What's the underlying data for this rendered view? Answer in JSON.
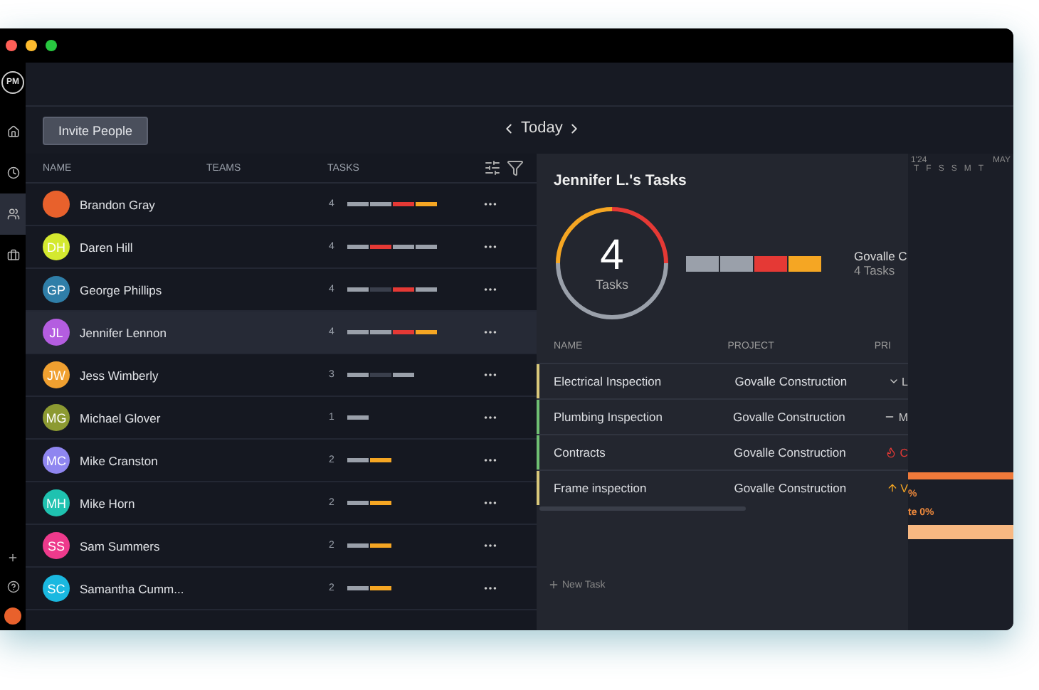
{
  "sidebar": {
    "logo": "PM",
    "items": [
      {
        "kind": "home",
        "selected": false
      },
      {
        "kind": "clock",
        "selected": false
      },
      {
        "kind": "people",
        "selected": true
      },
      {
        "kind": "briefcase",
        "selected": false
      }
    ],
    "bottom": [
      {
        "kind": "plus"
      },
      {
        "kind": "help"
      },
      {
        "kind": "avatar"
      }
    ]
  },
  "toolbar": {
    "invite_button": "Invite People",
    "date_nav": "Today"
  },
  "members": {
    "columns": [
      "NAME",
      "TEAMS",
      "TASKS"
    ],
    "rows": [
      {
        "initials": "",
        "color": "#e8612c",
        "name": "Brandon Gray",
        "count": "4",
        "selected": false,
        "segments": [
          {
            "color": "#9aa0aa"
          },
          {
            "color": "#9aa0aa"
          },
          {
            "color": "#e53935"
          },
          {
            "color": "#f5a623"
          }
        ]
      },
      {
        "initials": "DH",
        "color": "#d4e92f",
        "name": "Daren Hill",
        "count": "4",
        "selected": false,
        "segments": [
          {
            "color": "#9aa0aa"
          },
          {
            "color": "#e53935"
          },
          {
            "color": "#9aa0aa"
          },
          {
            "color": "#9aa0aa"
          }
        ]
      },
      {
        "initials": "GP",
        "color": "#2f7ea8",
        "name": "George Phillips",
        "count": "4",
        "selected": false,
        "segments": [
          {
            "color": "#9aa0aa"
          },
          {
            "color": "#3a3f4c"
          },
          {
            "color": "#e53935"
          },
          {
            "color": "#9aa0aa"
          }
        ]
      },
      {
        "initials": "JL",
        "color": "#b45de0",
        "name": "Jennifer Lennon",
        "count": "4",
        "selected": true,
        "segments": [
          {
            "color": "#9aa0aa"
          },
          {
            "color": "#9aa0aa"
          },
          {
            "color": "#e53935"
          },
          {
            "color": "#f5a623"
          }
        ]
      },
      {
        "initials": "JW",
        "color": "#f0a030",
        "name": "Jess Wimberly",
        "count": "3",
        "selected": false,
        "segments": [
          {
            "color": "#9aa0aa"
          },
          {
            "color": "#3a3f4c"
          },
          {
            "color": "#9aa0aa"
          }
        ]
      },
      {
        "initials": "MG",
        "color": "#8c9a32",
        "name": "Michael Glover",
        "count": "1",
        "selected": false,
        "segments": [
          {
            "color": "#9aa0aa"
          }
        ]
      },
      {
        "initials": "MC",
        "color": "#8f86f0",
        "name": "Mike Cranston",
        "count": "2",
        "selected": false,
        "segments": [
          {
            "color": "#9aa0aa"
          },
          {
            "color": "#f5a623"
          }
        ]
      },
      {
        "initials": "MH",
        "color": "#1fc2b0",
        "name": "Mike Horn",
        "count": "2",
        "selected": false,
        "segments": [
          {
            "color": "#9aa0aa"
          },
          {
            "color": "#f5a623"
          }
        ]
      },
      {
        "initials": "SS",
        "color": "#ee3a8c",
        "name": "Sam Summers",
        "count": "2",
        "selected": false,
        "segments": [
          {
            "color": "#9aa0aa"
          },
          {
            "color": "#f5a623"
          }
        ]
      },
      {
        "initials": "SC",
        "color": "#1ab8e0",
        "name": "Samantha Cumm...",
        "count": "2",
        "selected": false,
        "segments": [
          {
            "color": "#9aa0aa"
          },
          {
            "color": "#f5a623"
          }
        ]
      }
    ]
  },
  "details": {
    "title": "Jennifer L.'s Tasks",
    "total": "4",
    "total_label": "Tasks",
    "segments": [
      {
        "color": "#9aa0aa"
      },
      {
        "color": "#9aa0aa"
      },
      {
        "color": "#e53935"
      },
      {
        "color": "#f5a623"
      }
    ],
    "project_name": "Govalle C",
    "project_tasks": "4 Tasks",
    "columns": [
      "NAME",
      "PROJECT",
      "PRI"
    ],
    "tasks": [
      {
        "name": "Electrical Inspection",
        "project": "Govalle Construction",
        "kind": "low",
        "priority_text": "L",
        "color": "#d8c77a"
      },
      {
        "name": "Plumbing Inspection",
        "project": "Govalle Construction",
        "kind": "medium",
        "priority_text": "M",
        "color": "#6fbf73"
      },
      {
        "name": "Contracts",
        "project": "Govalle Construction",
        "kind": "critical",
        "priority_text": "C",
        "color": "#6fbf73"
      },
      {
        "name": "Frame inspection",
        "project": "Govalle Construction",
        "kind": "high",
        "priority_text": "V",
        "color": "#d8c77a"
      }
    ],
    "new_task": "New Task"
  },
  "gantt": {
    "month_left": "1'24",
    "month_right": "MAY",
    "days": [
      "T",
      "F",
      "S",
      "S",
      "M",
      "T"
    ],
    "label_1": "%",
    "label_2": "te 0%"
  }
}
